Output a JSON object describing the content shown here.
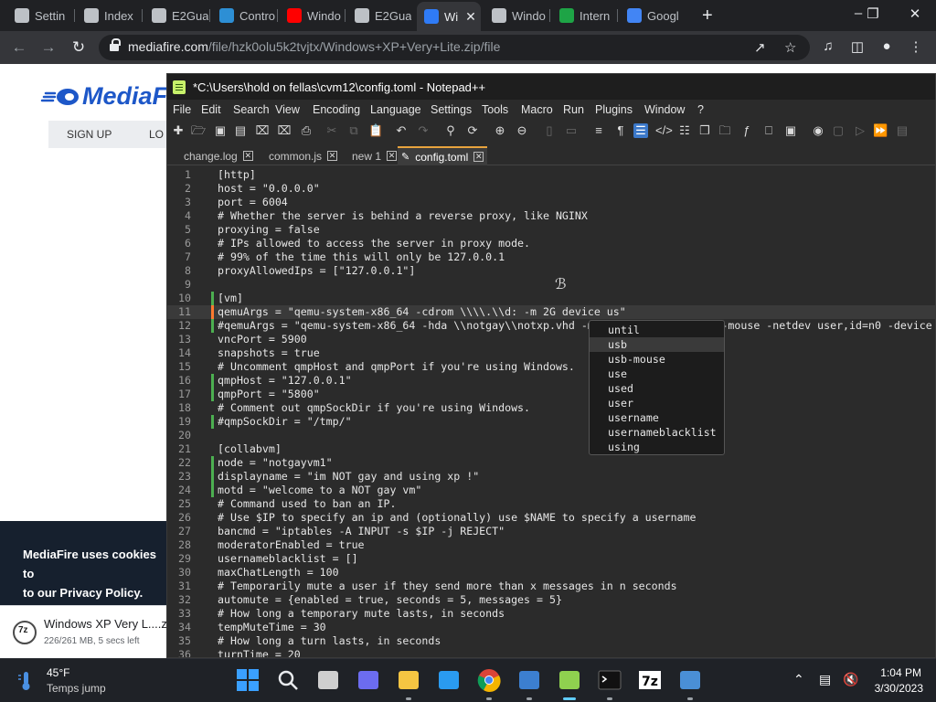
{
  "browser": {
    "tabs": [
      {
        "label": "Settin",
        "icon": "gear-icon",
        "color": "#bdc1c6"
      },
      {
        "label": "Index",
        "icon": "wiki-icon",
        "color": "#bdc1c6"
      },
      {
        "label": "E2Gua",
        "icon": "globe-icon",
        "color": "#bdc1c6"
      },
      {
        "label": "Contro",
        "icon": "control-panel-icon",
        "color": "#2d8fd5"
      },
      {
        "label": "Windo",
        "icon": "youtube-icon",
        "color": "#ff0000"
      },
      {
        "label": "E2Gua",
        "icon": "globe-icon",
        "color": "#bdc1c6"
      },
      {
        "label": "Wi",
        "icon": "mediafire-icon",
        "color": "#2f7bf6"
      },
      {
        "label": "Windo",
        "icon": "archive-icon",
        "color": "#bdc1c6"
      },
      {
        "label": "Intern",
        "icon": "play-icon",
        "color": "#1ea446"
      },
      {
        "label": "Googl",
        "icon": "google-icon",
        "color": "#4285f4"
      }
    ],
    "url_host": "mediafire.com",
    "url_path": "/file/hzk0olu5k2tvjtx/Windows+XP+Very+Lite.zip/file"
  },
  "mediafire": {
    "logo_text": "MediaF",
    "nav_signup": "SIGN UP",
    "nav_login": "LO",
    "cookie_text": "MediaFire uses cookies to",
    "cookie_text2": "to our Privacy Policy.",
    "download_name": "Windows XP Very L....zi",
    "download_status": "226/261 MB, 5 secs left"
  },
  "notepadpp": {
    "title": "*C:\\Users\\hold on fellas\\cvm12\\config.toml - Notepad++",
    "menu": [
      "File",
      "Edit",
      "Search",
      "View",
      "Encoding",
      "Language",
      "Settings",
      "Tools",
      "Macro",
      "Run",
      "Plugins",
      "Window",
      "?"
    ],
    "tabs": [
      {
        "label": "change.log"
      },
      {
        "label": "common.js"
      },
      {
        "label": "new 1"
      },
      {
        "label": "config.toml"
      }
    ],
    "lines": [
      {
        "n": "1",
        "text": "[http]",
        "mark": ""
      },
      {
        "n": "2",
        "text": "host = \"0.0.0.0\"",
        "mark": ""
      },
      {
        "n": "3",
        "text": "port = 6004",
        "mark": ""
      },
      {
        "n": "4",
        "text": "# Whether the server is behind a reverse proxy, like NGINX",
        "mark": ""
      },
      {
        "n": "5",
        "text": "proxying = false",
        "mark": ""
      },
      {
        "n": "6",
        "text": "# IPs allowed to access the server in proxy mode.",
        "mark": ""
      },
      {
        "n": "7",
        "text": "# 99% of the time this will only be 127.0.0.1",
        "mark": ""
      },
      {
        "n": "8",
        "text": "proxyAllowedIps = [\"127.0.0.1\"]",
        "mark": ""
      },
      {
        "n": "9",
        "text": "",
        "mark": ""
      },
      {
        "n": "10",
        "text": "[vm]",
        "mark": "saved"
      },
      {
        "n": "11",
        "text": "qemuArgs = \"qemu-system-x86_64 -cdrom \\\\\\\\.\\\\d: -m 2G device us\"",
        "mark": "modified"
      },
      {
        "n": "12",
        "text": "#qemuArgs = \"qemu-system-x86_64 -hda \\\\notgay\\\\notxp.vhd -m                    -mouse -netdev user,id=n0 -device",
        "mark": "saved"
      },
      {
        "n": "13",
        "text": "vncPort = 5900",
        "mark": ""
      },
      {
        "n": "14",
        "text": "snapshots = true",
        "mark": ""
      },
      {
        "n": "15",
        "text": "# Uncomment qmpHost and qmpPort if you're using Windows.",
        "mark": ""
      },
      {
        "n": "16",
        "text": "qmpHost = \"127.0.0.1\"",
        "mark": "saved"
      },
      {
        "n": "17",
        "text": "qmpPort = \"5800\"",
        "mark": "saved"
      },
      {
        "n": "18",
        "text": "# Comment out qmpSockDir if you're using Windows.",
        "mark": ""
      },
      {
        "n": "19",
        "text": "#qmpSockDir = \"/tmp/\"",
        "mark": "saved"
      },
      {
        "n": "20",
        "text": "",
        "mark": ""
      },
      {
        "n": "21",
        "text": "[collabvm]",
        "mark": ""
      },
      {
        "n": "22",
        "text": "node = \"notgayvm1\"",
        "mark": "saved"
      },
      {
        "n": "23",
        "text": "displayname = \"im NOT gay and using xp !\"",
        "mark": "saved"
      },
      {
        "n": "24",
        "text": "motd = \"welcome to a NOT gay vm\"",
        "mark": "saved"
      },
      {
        "n": "25",
        "text": "# Command used to ban an IP.",
        "mark": ""
      },
      {
        "n": "26",
        "text": "# Use $IP to specify an ip and (optionally) use $NAME to specify a username",
        "mark": ""
      },
      {
        "n": "27",
        "text": "bancmd = \"iptables -A INPUT -s $IP -j REJECT\"",
        "mark": ""
      },
      {
        "n": "28",
        "text": "moderatorEnabled = true",
        "mark": ""
      },
      {
        "n": "29",
        "text": "usernameblacklist = []",
        "mark": ""
      },
      {
        "n": "30",
        "text": "maxChatLength = 100",
        "mark": ""
      },
      {
        "n": "31",
        "text": "# Temporarily mute a user if they send more than x messages in n seconds",
        "mark": ""
      },
      {
        "n": "32",
        "text": "automute = {enabled = true, seconds = 5, messages = 5}",
        "mark": ""
      },
      {
        "n": "33",
        "text": "# How long a temporary mute lasts, in seconds",
        "mark": ""
      },
      {
        "n": "34",
        "text": "tempMuteTime = 30",
        "mark": ""
      },
      {
        "n": "35",
        "text": "# How long a turn lasts, in seconds",
        "mark": ""
      },
      {
        "n": "36",
        "text": "turnTime = 20",
        "mark": ""
      }
    ],
    "current_line": "11",
    "autocomplete": {
      "items": [
        "until",
        "usb",
        "usb-mouse",
        "use",
        "used",
        "user",
        "username",
        "usernameblacklist",
        "using"
      ],
      "selected": "usb"
    }
  },
  "colors": {
    "marker_saved": "#4caf50",
    "marker_modified": "#ff7a2f",
    "active_tab_accent": "#e8a33d"
  },
  "taskbar": {
    "weather_temp": "45°F",
    "weather_desc": "Temps jump",
    "apps": [
      "windows-start-icon",
      "search-icon",
      "task-view-icon",
      "zoom-icon",
      "file-explorer-icon",
      "microsoft-store-icon",
      "chrome-icon",
      "remote-desktop-icon",
      "notepadpp-icon",
      "terminal-icon",
      "7zip-icon",
      "vm-manager-icon"
    ],
    "active_app": "notepadpp-icon",
    "clock_time": "1:04 PM",
    "clock_date": "3/30/2023"
  }
}
